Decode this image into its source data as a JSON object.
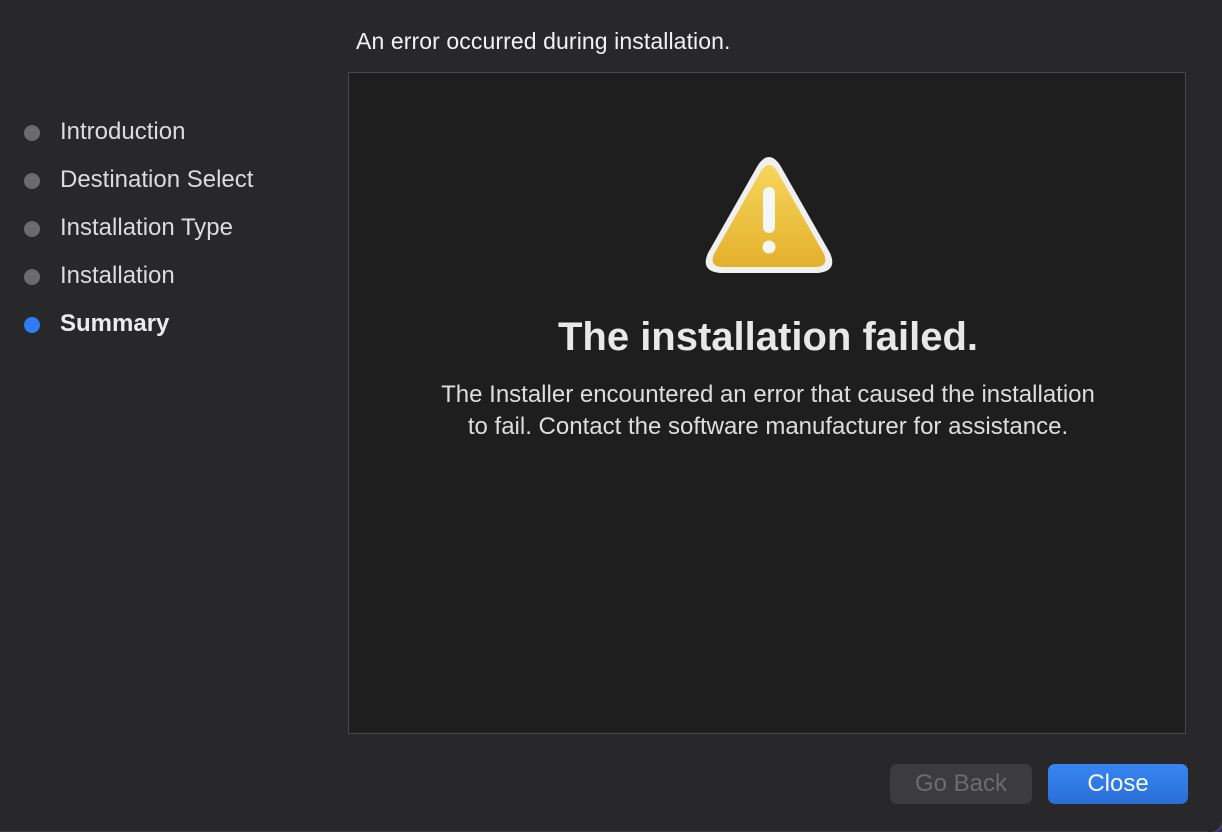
{
  "header": {
    "title": "An error occurred during installation."
  },
  "sidebar": {
    "steps": [
      {
        "label": "Introduction",
        "state": "done"
      },
      {
        "label": "Destination Select",
        "state": "done"
      },
      {
        "label": "Installation Type",
        "state": "done"
      },
      {
        "label": "Installation",
        "state": "done"
      },
      {
        "label": "Summary",
        "state": "current"
      }
    ]
  },
  "content": {
    "icon": "warning-triangle-icon",
    "title": "The installation failed.",
    "message": "The Installer encountered an error that caused the installation to fail. Contact the software manufacturer for assistance."
  },
  "buttons": {
    "back_label": "Go Back",
    "back_enabled": false,
    "close_label": "Close"
  },
  "colors": {
    "accent": "#2f7cf6",
    "warning": "#f0c030"
  }
}
